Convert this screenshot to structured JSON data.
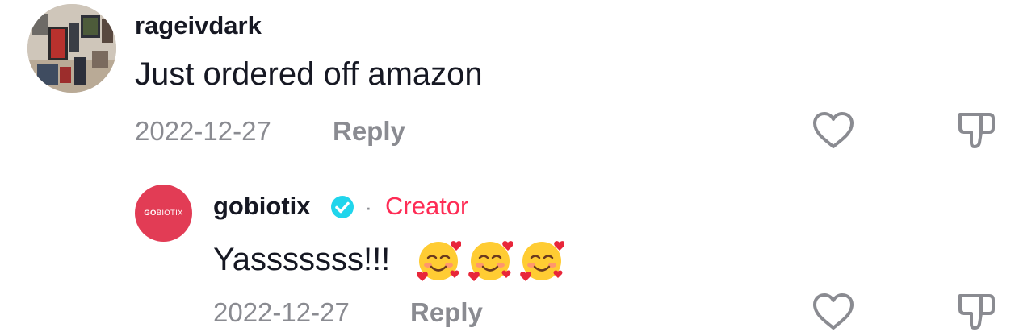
{
  "comment": {
    "username": "rageivdark",
    "text": "Just ordered off amazon",
    "date": "2022-12-27",
    "reply_label": "Reply"
  },
  "reply": {
    "username": "gobiotix",
    "creator_label": "Creator",
    "separator": "·",
    "text": "Yasssssss!!!",
    "emoji_count": 3,
    "emoji_name": "smiling-face-with-hearts",
    "date": "2022-12-27",
    "reply_label": "Reply",
    "avatar_logo": {
      "bold": "GO",
      "light": "BIOTIX"
    }
  },
  "colors": {
    "text_primary": "#161823",
    "text_secondary": "#8a8b91",
    "creator": "#fe2c55",
    "verified": "#20d5ec",
    "brand_avatar": "#e23c55"
  },
  "icons": [
    "like-heart-icon",
    "dislike-thumb-icon",
    "verified-badge-icon"
  ]
}
